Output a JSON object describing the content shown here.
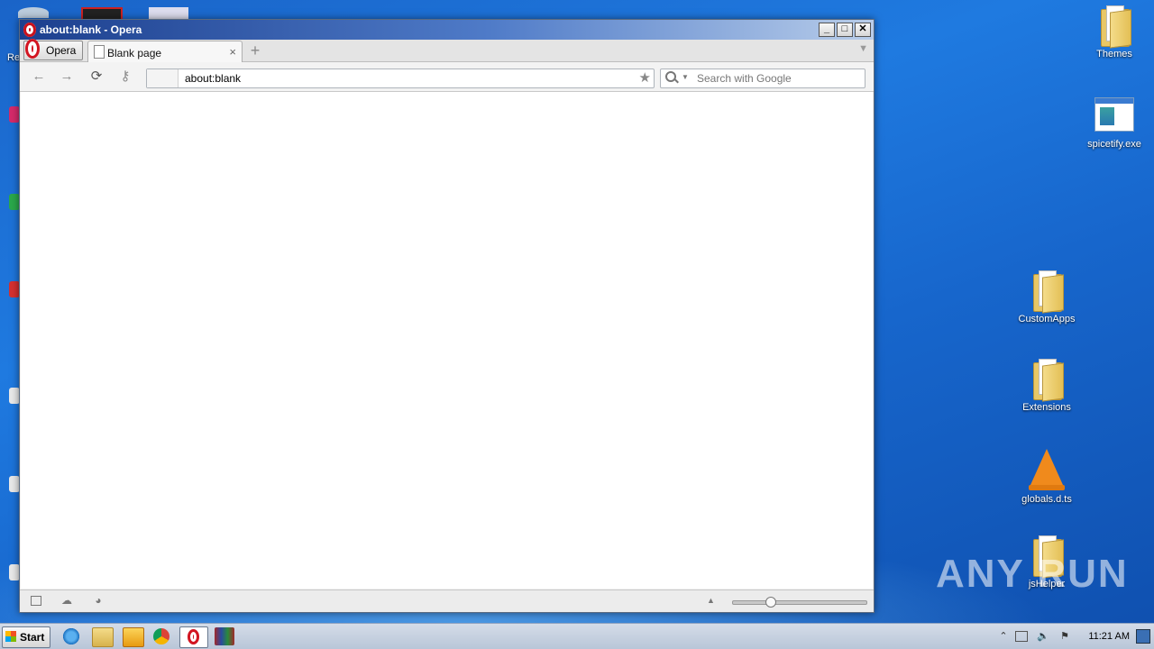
{
  "desktop": {
    "icons": [
      {
        "label": "Themes",
        "kind": "folder"
      },
      {
        "label": "spicetify.exe",
        "kind": "exe"
      },
      {
        "label": "CustomApps",
        "kind": "folder"
      },
      {
        "label": "Extensions",
        "kind": "folder"
      },
      {
        "label": "globals.d.ts",
        "kind": "vlc"
      },
      {
        "label": "jsHelper",
        "kind": "folder"
      }
    ],
    "partial_left_label": "Re",
    "watermark": "ANY RUN"
  },
  "window": {
    "title": "about:blank - Opera",
    "controls": {
      "minimize": "_",
      "maximize": "□",
      "close": "✕"
    },
    "menu_button": "Opera",
    "tabs": [
      {
        "label": "Blank page",
        "close": "×"
      }
    ],
    "new_tab": "+",
    "address": {
      "value": "about:blank"
    },
    "search": {
      "placeholder": "Search with Google"
    },
    "nav": {
      "back": "←",
      "forward": "→",
      "reload": "⟳",
      "key": "⚷"
    }
  },
  "taskbar": {
    "start_label": "Start",
    "clock": "11:21 AM",
    "apps": [
      "ie-icon",
      "explorer-icon",
      "media-player-icon",
      "chrome-icon",
      "opera-icon",
      "winrar-icon"
    ]
  },
  "colors": {
    "desktop": "#1f7ae0",
    "opera_red": "#d21521",
    "titlebar": "#1c3f8e"
  }
}
